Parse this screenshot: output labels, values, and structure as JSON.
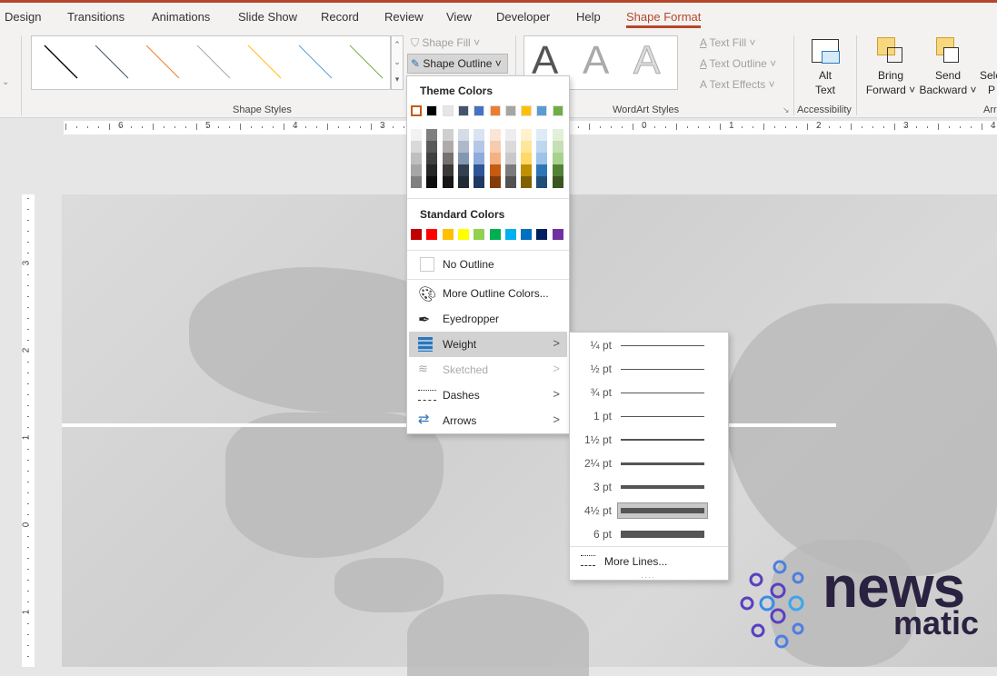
{
  "tabs": [
    "Design",
    "Transitions",
    "Animations",
    "Slide Show",
    "Record",
    "Review",
    "View",
    "Developer",
    "Help",
    "Shape Format"
  ],
  "active_tab": "Shape Format",
  "ribbon": {
    "shape_fill": "Shape Fill",
    "shape_outline": "Shape Outline",
    "shape_styles": "Shape Styles",
    "text_fill": "Text Fill",
    "text_outline": "Text Outline",
    "text_effects": "Text Effects",
    "wordart_styles": "WordArt Styles",
    "alt_text_1": "Alt",
    "alt_text_2": "Text",
    "accessibility": "Accessibility",
    "bring_1": "Bring",
    "bring_2": "Forward",
    "send_1": "Send",
    "send_2": "Backward",
    "select_1": "Sele",
    "select_2": "P",
    "arrange": "Arr",
    "style_colors": [
      "#000000",
      "#44546a",
      "#ed7d31",
      "#a5a5a5",
      "#ffc000",
      "#5b9bd5",
      "#70ad47"
    ]
  },
  "ruler": {
    "h_labels": [
      "6",
      "5",
      "4",
      "3",
      "0",
      "1",
      "2",
      "3",
      "4"
    ],
    "v_labels": [
      "3",
      "2",
      "1",
      "0",
      "1"
    ]
  },
  "menu": {
    "theme_colors_label": "Theme Colors",
    "theme_colors": [
      "#ffffff",
      "#000000",
      "#e7e6e6",
      "#44546a",
      "#4472c4",
      "#ed7d31",
      "#a5a5a5",
      "#ffc000",
      "#5b9bd5",
      "#70ad47"
    ],
    "theme_shades": [
      [
        "#f2f2f2",
        "#d9d9d9",
        "#bfbfbf",
        "#a6a6a6",
        "#808080"
      ],
      [
        "#7f7f7f",
        "#595959",
        "#404040",
        "#262626",
        "#0d0d0d"
      ],
      [
        "#d0cece",
        "#afabab",
        "#767171",
        "#3b3838",
        "#171616"
      ],
      [
        "#d6dce5",
        "#adb9ca",
        "#8497b0",
        "#333f50",
        "#222a35"
      ],
      [
        "#dae3f3",
        "#b4c7e7",
        "#8faadc",
        "#2f5597",
        "#203864"
      ],
      [
        "#fbe5d6",
        "#f8cbad",
        "#f4b183",
        "#c55a11",
        "#843c0c"
      ],
      [
        "#ededed",
        "#dbdbdb",
        "#c9c9c9",
        "#7b7b7b",
        "#525252"
      ],
      [
        "#fff2cc",
        "#ffe699",
        "#ffd966",
        "#bf9000",
        "#7f6000"
      ],
      [
        "#deebf7",
        "#bdd7ee",
        "#9dc3e6",
        "#2e75b6",
        "#1f4e79"
      ],
      [
        "#e2f0d9",
        "#c5e0b4",
        "#a9d18e",
        "#548235",
        "#385723"
      ]
    ],
    "standard_colors_label": "Standard Colors",
    "standard_colors": [
      "#c00000",
      "#ff0000",
      "#ffc000",
      "#ffff00",
      "#92d050",
      "#00b050",
      "#00b0f0",
      "#0070c0",
      "#002060",
      "#7030a0"
    ],
    "no_outline": "No Outline",
    "more_colors": "More Outline Colors...",
    "eyedropper": "Eyedropper",
    "weight": "Weight",
    "sketched": "Sketched",
    "dashes": "Dashes",
    "arrows": "Arrows"
  },
  "weights": {
    "items": [
      {
        "label": "¼ pt",
        "pt": 0.25
      },
      {
        "label": "½ pt",
        "pt": 0.5
      },
      {
        "label": "¾ pt",
        "pt": 0.75
      },
      {
        "label": "1 pt",
        "pt": 1
      },
      {
        "label": "1½ pt",
        "pt": 1.5
      },
      {
        "label": "2¼ pt",
        "pt": 2.25
      },
      {
        "label": "3 pt",
        "pt": 3
      },
      {
        "label": "4½ pt",
        "pt": 4.5
      },
      {
        "label": "6 pt",
        "pt": 6
      }
    ],
    "selected": "4½ pt",
    "more_lines": "More Lines..."
  },
  "logo": {
    "line1": "news",
    "line2": "matic"
  }
}
